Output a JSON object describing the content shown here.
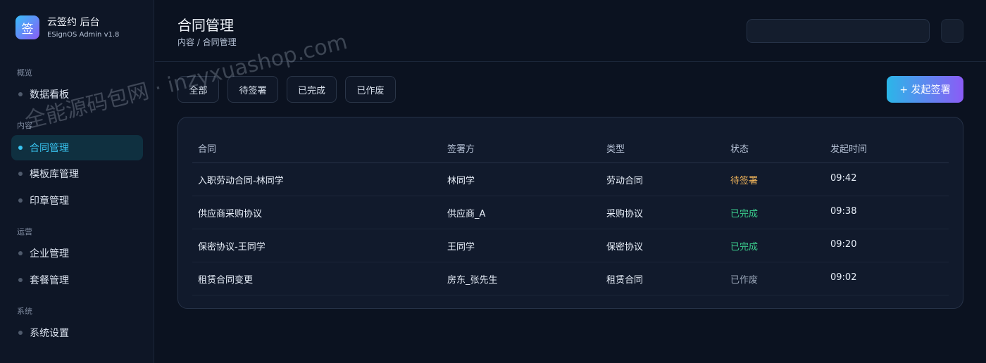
{
  "brand": {
    "logo_char": "签",
    "title": "云签约 后台",
    "subtitle": "ESignOS Admin v1.8"
  },
  "sidebar": {
    "groups": [
      {
        "label": "概览",
        "items": [
          {
            "label": "数据看板",
            "active": false
          }
        ]
      },
      {
        "label": "内容",
        "items": [
          {
            "label": "合同管理",
            "active": true
          },
          {
            "label": "模板库管理",
            "active": false
          },
          {
            "label": "印章管理",
            "active": false
          }
        ]
      },
      {
        "label": "运营",
        "items": [
          {
            "label": "企业管理",
            "active": false
          },
          {
            "label": "套餐管理",
            "active": false
          }
        ]
      },
      {
        "label": "系统",
        "items": [
          {
            "label": "系统设置",
            "active": false
          }
        ]
      }
    ]
  },
  "header": {
    "title": "合同管理",
    "breadcrumb": "内容 / 合同管理",
    "search_value": ""
  },
  "filters": [
    "全部",
    "待签署",
    "已完成",
    "已作废"
  ],
  "primary_button": "+ 发起签署",
  "table": {
    "columns": [
      "合同",
      "签署方",
      "类型",
      "状态",
      "发起时间"
    ],
    "rows": [
      {
        "contract": "入职劳动合同-林同学",
        "party": "林同学",
        "type": "劳动合同",
        "status": "待签署",
        "status_kind": "pending",
        "time": "09:42"
      },
      {
        "contract": "供应商采购协议",
        "party": "供应商_A",
        "type": "采购协议",
        "status": "已完成",
        "status_kind": "done",
        "time": "09:38"
      },
      {
        "contract": "保密协议-王同学",
        "party": "王同学",
        "type": "保密协议",
        "status": "已完成",
        "status_kind": "done",
        "time": "09:20"
      },
      {
        "contract": "租赁合同变更",
        "party": "房东_张先生",
        "type": "租赁合同",
        "status": "已作废",
        "status_kind": "void",
        "time": "09:02"
      }
    ]
  },
  "watermark": "全能源码包网 · inzyxuashop.com",
  "colors": {
    "accent": "#38c4f0",
    "pending": "#f0b45a",
    "done": "#3ccf8e",
    "void": "#9aa6b8"
  }
}
